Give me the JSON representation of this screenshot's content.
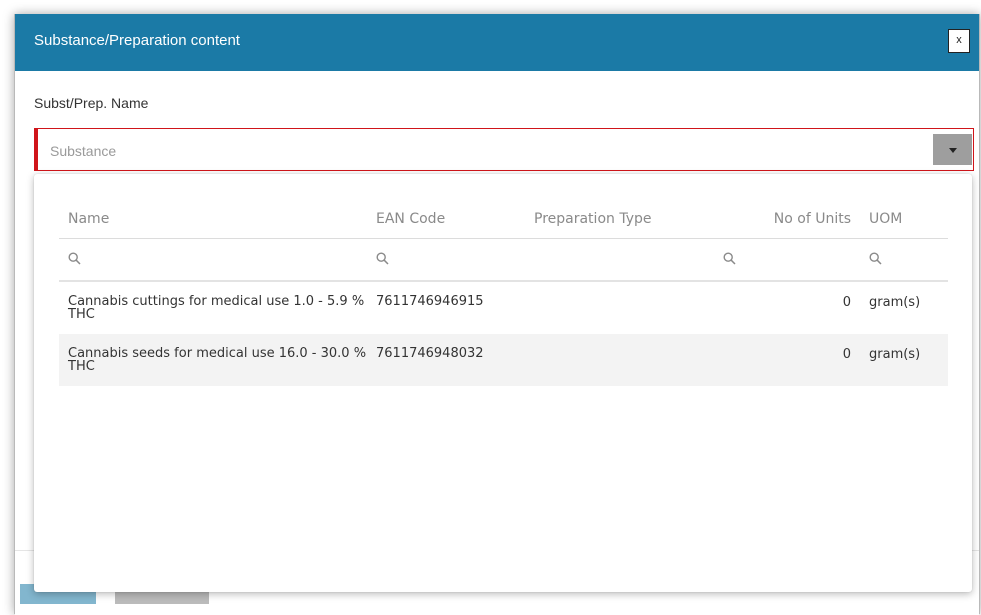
{
  "dialog": {
    "title": "Substance/Preparation content",
    "close_label": "x"
  },
  "form": {
    "field_label": "Subst/Prep. Name",
    "substance_input": {
      "value": "",
      "placeholder": "Substance"
    }
  },
  "grid": {
    "columns": [
      "Name",
      "EAN Code",
      "Preparation Type",
      "No of Units",
      "UOM"
    ],
    "rows": [
      {
        "name": "Cannabis cuttings for medical use 1.0 - 5.9 % THC",
        "ean": "7611746946915",
        "preparation_type": "",
        "units": "0",
        "uom": "gram(s)"
      },
      {
        "name": "Cannabis seeds for medical use 16.0 - 30.0 % THC",
        "ean": "7611746948032",
        "preparation_type": "",
        "units": "0",
        "uom": "gram(s)"
      }
    ]
  },
  "colors": {
    "header_bg": "#1b7aa6",
    "error_border": "#d0151a",
    "dropdown_button": "#9e9e9e"
  },
  "icons": {
    "filter": "search-icon",
    "dropdown": "caret-down-icon",
    "close": "close-icon"
  }
}
